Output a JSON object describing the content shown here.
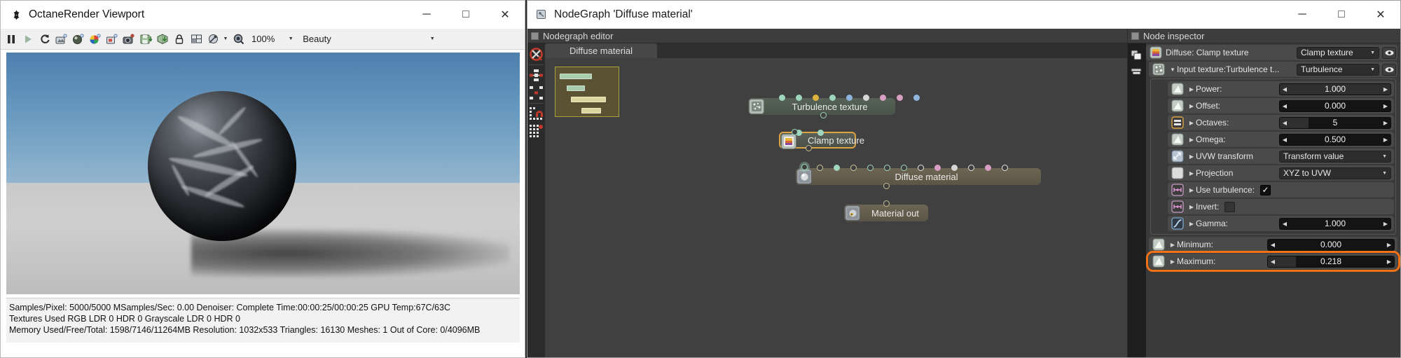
{
  "viewport": {
    "title": "OctaneRender Viewport",
    "title_icon": "octane-logo-icon",
    "window_buttons": [
      {
        "name": "minimize-button",
        "glyph": "─"
      },
      {
        "name": "maximize-button",
        "glyph": "□"
      },
      {
        "name": "close-button",
        "glyph": "✕"
      }
    ],
    "toolbar": {
      "icons": [
        "pause-icon",
        "play-icon",
        "restart-render-icon",
        "render-region-icon",
        "render-target-icon",
        "color-picker-icon",
        "render-layer-icon",
        "camera-snapshot-icon",
        "save-image-icon",
        "save-render-icon",
        "lock-resolution-icon",
        "grid-overlay-icon",
        "pick-focus-icon",
        "zoom-region-icon"
      ],
      "zoom": "100%",
      "render_mode": "Beauty"
    },
    "status": {
      "line1": "Samples/Pixel: 5000/5000  MSamples/Sec: 0.00  Denoiser: Complete  Time:00:00:25/00:00:25  GPU Temp:67C/63C",
      "line2": "Textures Used RGB LDR 0  HDR 0  Grayscale LDR 0  HDR 0",
      "line3": "Memory Used/Free/Total: 1598/7146/11264MB  Resolution: 1032x533  Triangles: 16130  Meshes: 1 Out of Core: 0/4096MB"
    }
  },
  "nodegraph_window": {
    "title": "NodeGraph 'Diffuse material'",
    "title_icon": "nodegraph-icon",
    "window_buttons": [
      {
        "name": "minimize-button",
        "glyph": "─"
      },
      {
        "name": "maximize-button",
        "glyph": "□"
      },
      {
        "name": "close-button",
        "glyph": "✕"
      }
    ],
    "editor": {
      "header": "Nodegraph editor",
      "tab": "Diffuse material",
      "sidebar_icons": [
        "delete-node-icon",
        "align-nodes-icon",
        "distribute-nodes-icon",
        "snap-to-grid-icon",
        "show-grid-icon"
      ],
      "nodes": [
        {
          "name": "turbulence-texture-node",
          "label": "Turbulence texture",
          "icon": "turbulence-texture-icon",
          "selected": false,
          "ports": [
            "#9fd6bd",
            "#9fd6bd",
            "#e0b43c",
            "#9fd6bd",
            "#8fb4dd",
            "#d7d7d7",
            "#d79fc4",
            "#d79fc4",
            "#8fb4dd"
          ]
        },
        {
          "name": "clamp-texture-node",
          "label": "Clamp texture",
          "icon": "clamp-texture-icon",
          "selected": true,
          "ports": [
            "#9fd6bd",
            "#9fd6bd"
          ]
        },
        {
          "name": "diffuse-material-node",
          "label": "Diffuse material",
          "icon": "diffuse-material-icon",
          "selected": false,
          "ports": [
            "#9fd6bd",
            "#cfc79a",
            "#9fd6bd",
            "#cfc79a",
            "#9fd6bd",
            "#9fd6bd",
            "#9fd6bd",
            "#cfc79a",
            "#d79fc4",
            "#d7d7d7",
            "#cfc79a",
            "#d79fc4",
            "#cfc79a"
          ]
        },
        {
          "name": "material-out-node",
          "label": "Material out",
          "icon": "material-out-icon",
          "selected": false,
          "ports": []
        }
      ],
      "minimap_bars": [
        "#a8ccae",
        "#a8ccae",
        "#ddd5a0",
        "#ddd5a0"
      ]
    },
    "inspector": {
      "header": "Node inspector",
      "sidebar_icons": [
        "copy-node-icon",
        "paste-node-icon"
      ],
      "rows": [
        {
          "name": "diffuse-clamp-texture-row",
          "label": "Diffuse: Clamp texture",
          "icon": "clamp-texture-icon",
          "control": "combo",
          "value": "Clamp texture",
          "eye": true,
          "level": 0,
          "expander": ""
        },
        {
          "name": "input-texture-turbulence-row",
          "label": "Input texture:Turbulence t...",
          "icon": "turbulence-texture-icon",
          "control": "combo",
          "value": "Turbulence",
          "eye": true,
          "level": 1,
          "expander": "▼"
        },
        {
          "name": "power-row",
          "label": "Power:",
          "icon": "float-param-icon",
          "control": "slider",
          "value": "1.000",
          "fill": 100,
          "level": 2,
          "expander": "▶"
        },
        {
          "name": "offset-row",
          "label": "Offset:",
          "icon": "float-param-icon",
          "control": "slider",
          "value": "0.000",
          "fill": 0,
          "level": 2,
          "expander": "▶"
        },
        {
          "name": "octaves-row",
          "label": "Octaves:",
          "icon": "int-param-icon",
          "control": "slider",
          "value": "5",
          "fill": 26,
          "level": 2,
          "expander": "▶"
        },
        {
          "name": "omega-row",
          "label": "Omega:",
          "icon": "float-param-icon",
          "control": "slider",
          "value": "0.500",
          "fill": 0,
          "level": 2,
          "expander": "▶"
        },
        {
          "name": "uvw-transform-row",
          "label": "UVW transform",
          "icon": "transform-icon",
          "control": "combo",
          "value": "Transform value",
          "level": 2,
          "expander": "▶"
        },
        {
          "name": "projection-row",
          "label": "Projection",
          "icon": "projection-icon",
          "control": "combo",
          "value": "XYZ to UVW",
          "level": 2,
          "expander": "▶"
        },
        {
          "name": "use-turbulence-row",
          "label": "Use turbulence:",
          "icon": "bool-param-icon",
          "control": "checkbox",
          "value": "checked",
          "level": 2,
          "expander": "▶"
        },
        {
          "name": "invert-row",
          "label": "Invert:",
          "icon": "bool-param-icon",
          "control": "checkbox",
          "value": "unchecked",
          "level": 2,
          "expander": "▶"
        },
        {
          "name": "gamma-row",
          "label": "Gamma:",
          "icon": "curve-param-icon",
          "control": "slider",
          "value": "1.000",
          "fill": 0,
          "level": 2,
          "expander": "▶"
        },
        {
          "name": "minimum-row",
          "label": "Minimum:",
          "icon": "float-param-icon",
          "control": "slider",
          "value": "0.000",
          "fill": 0,
          "level": 1,
          "expander": "▶"
        },
        {
          "name": "maximum-row",
          "label": "Maximum:",
          "icon": "float-param-icon",
          "control": "slider",
          "value": "0.218",
          "fill": 22,
          "level": 1,
          "expander": "▶",
          "highlighted": true
        }
      ]
    }
  },
  "colors": {
    "highlight_orange": "#f47216",
    "node_selected_border": "#d9a441",
    "link_green": "#9fd6bd",
    "link_tan": "#c7bf93"
  }
}
